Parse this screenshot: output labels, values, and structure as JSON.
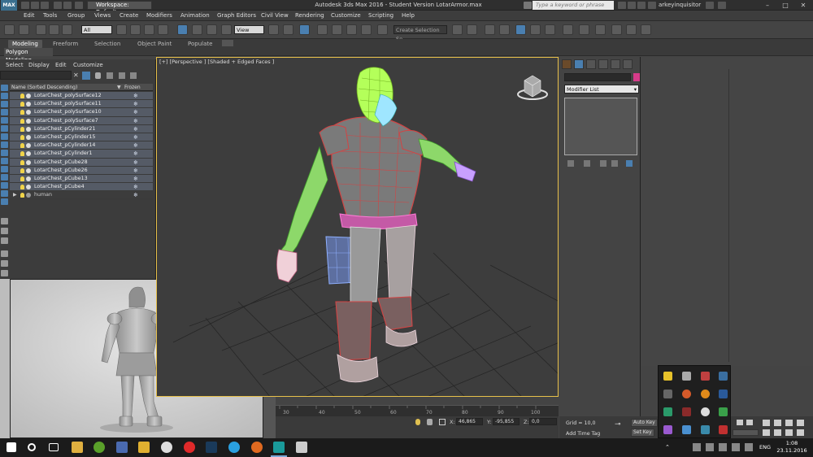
{
  "titlebar": {
    "logo": "MAX",
    "workspace_label": "Workspace: Default",
    "window_title": "Autodesk 3ds Max 2016 - Student Version    LotarArmor.max",
    "search_placeholder": "Type a keyword or phrase",
    "user_name": "arkeyinquisitor"
  },
  "menu": [
    "Edit",
    "Tools",
    "Group",
    "Views",
    "Create",
    "Modifiers",
    "Animation",
    "Graph Editors",
    "Civil View",
    "Rendering",
    "Customize",
    "Scripting",
    "Help"
  ],
  "toolbar": {
    "filter_value": "All",
    "refcoord_value": "View",
    "selection_set_placeholder": "Create Selection Se"
  },
  "ribbon": {
    "tabs": [
      "Modeling",
      "Freeform",
      "Selection",
      "Object Paint",
      "Populate"
    ],
    "active_tab": "Modeling",
    "sub_label": "Polygon Modeling"
  },
  "explorer": {
    "menu": [
      "Select",
      "Display",
      "Edit",
      "Customize"
    ],
    "col_name": "Name (Sorted Descending)",
    "col_frozen": "Frozen",
    "rows": [
      "LotarChest_polySurface12",
      "LotarChest_polySurface11",
      "LotarChest_polySurface10",
      "LotarChest_polySurface7",
      "LotarChest_pCylinder21",
      "LotarChest_pCylinder15",
      "LotarChest_pCylinder14",
      "LotarChest_pCylinder1",
      "LotarChest_pCube28",
      "LotarChest_pCube26",
      "LotarChest_pCube13",
      "LotarChest_pCube4"
    ],
    "group_row": "human",
    "frozen_glyph": "❄"
  },
  "viewport": {
    "label": "[+] [Perspective ] [Shaded + Edged Faces ]"
  },
  "timeline": {
    "ticks": [
      "30",
      "40",
      "50",
      "60",
      "70",
      "80",
      "90",
      "100"
    ]
  },
  "status": {
    "x_label": "X:",
    "x_value": "46,865",
    "y_label": "Y:",
    "y_value": "-95,855",
    "z_label": "Z:",
    "z_value": "0,0",
    "grid": "Grid = 10,0",
    "add_time_tag": "Add Time Tag",
    "auto_key": "Auto Key",
    "set_key": "Set Key"
  },
  "command_panel": {
    "modifier_list": "Modifier List"
  },
  "taskbar": {
    "lang": "ENG",
    "time": "1:08",
    "date": "23.11.2016"
  },
  "colors": {
    "viewport_border": "#e7c04a",
    "accent_blue": "#4a7fb0",
    "object_color": "#d63b8a"
  }
}
